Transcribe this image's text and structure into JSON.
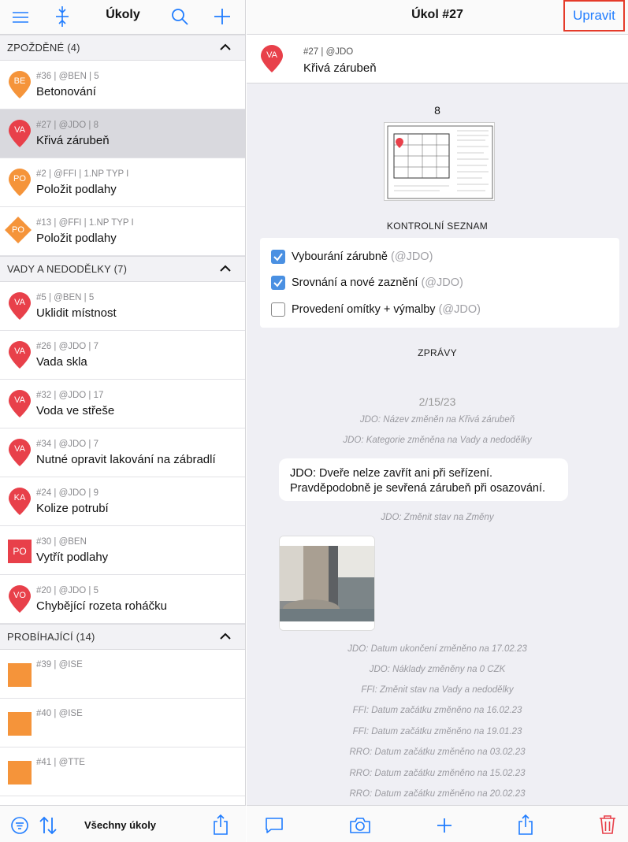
{
  "left": {
    "title": "Úkoly",
    "sections": [
      {
        "title": "ZPOŽDĚNÉ (4)"
      },
      {
        "title": "VADY A NEDODĚLKY (7)"
      },
      {
        "title": "PROBÍHAJÍCÍ (14)"
      }
    ],
    "rows": [
      {
        "meta": "#36 | @BEN | 5",
        "name": "Betonování",
        "badge": "BE"
      },
      {
        "meta": "#27 | @JDO | 8",
        "name": "Křivá zárubeň",
        "badge": "VA"
      },
      {
        "meta": "#2 | @FFI | 1.NP TYP I",
        "name": "Položit podlahy",
        "badge": "PO"
      },
      {
        "meta": "#13 | @FFI | 1.NP TYP I",
        "name": "Položit podlahy",
        "badge": "PO"
      },
      {
        "meta": "#5 | @BEN | 5",
        "name": "Uklidit místnost",
        "badge": "VA"
      },
      {
        "meta": "#26 | @JDO | 7",
        "name": "Vada skla",
        "badge": "VA"
      },
      {
        "meta": "#32 | @JDO | 17",
        "name": "Voda ve střeše",
        "badge": "VA"
      },
      {
        "meta": "#34 | @JDO | 7",
        "name": "Nutné opravit lakování na zábradlí",
        "badge": "VA"
      },
      {
        "meta": "#24 | @JDO | 9",
        "name": "Kolize potrubí",
        "badge": "KA"
      },
      {
        "meta": "#30 | @BEN",
        "name": "Vytřít podlahy",
        "badge": "PO"
      },
      {
        "meta": "#20 | @JDO | 5",
        "name": "Chybějící rozeta roháčku",
        "badge": "VO"
      },
      {
        "meta": "#39 | @ISE",
        "name": ""
      },
      {
        "meta": "#40 | @ISE",
        "name": ""
      },
      {
        "meta": "#41 | @TTE",
        "name": ""
      }
    ],
    "bottom_label": "Všechny úkoly"
  },
  "right": {
    "title": "Úkol #27",
    "edit_label": "Upravit",
    "header": {
      "meta": "#27 | @JDO",
      "name": "Křivá zárubeň",
      "badge": "VA"
    },
    "plan_number": "8",
    "checklist_title": "KONTROLNÍ SEZNAM",
    "checklist": [
      {
        "label": "Vybourání zárubně",
        "user": "(@JDO)",
        "checked": true
      },
      {
        "label": "Srovnání a nové zaznění",
        "user": "(@JDO)",
        "checked": true
      },
      {
        "label": "Provedení omítky + výmalby",
        "user": "(@JDO)",
        "checked": false
      }
    ],
    "messages_title": "ZPRÁVY",
    "date": "2/15/23",
    "sys1": "JDO: Název změněn na Křivá zárubeň",
    "sys2": "JDO: Kategorie změněna na Vady a nedodělky",
    "message": "JDO: Dveře nelze zavřít ani při seřízení. Pravděpodobně je sevřená zárubeň při osazování.",
    "sys3": "JDO: Změnit stav na Změny",
    "log": [
      "JDO: Datum ukončení změněno na 17.02.23",
      "JDO: Náklady změněny na 0 CZK",
      "FFI: Změnit stav na Vady a nedodělky",
      "FFI: Datum začátku změněno na 16.02.23",
      "FFI: Datum začátku změněno na 19.01.23",
      "RRO: Datum začátku změněno na 03.02.23",
      "RRO: Datum začátku změněno na 15.02.23",
      "RRO: Datum začátku změněno na 20.02.23"
    ]
  },
  "colors": {
    "accent": "#1f7cff",
    "red": "#e8404a",
    "orange": "#f5943a",
    "highlight": "#e53b2a"
  }
}
